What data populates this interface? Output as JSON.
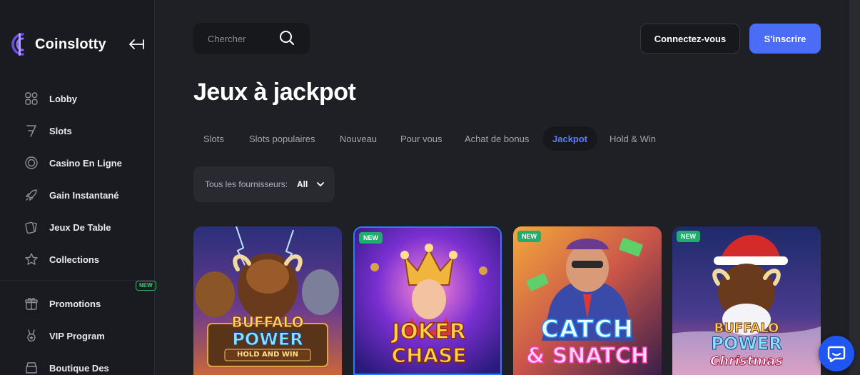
{
  "brand": {
    "name": "Coinslotty"
  },
  "sidebar": {
    "items": [
      {
        "label": "Lobby",
        "icon": "lobby-grid-icon"
      },
      {
        "label": "Slots",
        "icon": "seven-icon"
      },
      {
        "label": "Casino En Ligne",
        "icon": "chip-icon"
      },
      {
        "label": "Gain Instantané",
        "icon": "rocket-icon"
      },
      {
        "label": "Jeux De Table",
        "icon": "cards-icon"
      },
      {
        "label": "Collections",
        "icon": "star-icon"
      },
      {
        "label": "Promotions",
        "icon": "gift-icon"
      },
      {
        "label": "VIP Program",
        "icon": "medal-icon"
      },
      {
        "label": "Boutique Des",
        "icon": "shop-icon",
        "badge": "NEW"
      }
    ]
  },
  "header": {
    "search_placeholder": "Chercher",
    "login_label": "Connectez-vous",
    "signup_label": "S'inscrire"
  },
  "page": {
    "title": "Jeux à jackpot"
  },
  "tabs": [
    {
      "label": "Slots",
      "active": false
    },
    {
      "label": "Slots populaires",
      "active": false
    },
    {
      "label": "Nouveau",
      "active": false
    },
    {
      "label": "Pour vous",
      "active": false
    },
    {
      "label": "Achat de bonus",
      "active": false
    },
    {
      "label": "Jackpot",
      "active": true
    },
    {
      "label": "Hold & Win",
      "active": false
    }
  ],
  "filter": {
    "label": "Tous les fournisseurs:",
    "value": "All"
  },
  "games": [
    {
      "line1": "BUFFALO",
      "line2": "POWER",
      "line3": "HOLD AND WIN",
      "badge": ""
    },
    {
      "line1": "JOKER",
      "line2": "CHASE",
      "line3": "",
      "badge": "NEW"
    },
    {
      "line1": "CATCH",
      "line2": "& SNATCH",
      "line3": "",
      "badge": "NEW"
    },
    {
      "line1": "BUFFALO",
      "line2": "POWER",
      "line3": "Christmas",
      "badge": "NEW"
    }
  ],
  "colors": {
    "accent": "#4a6cf7",
    "active_tab": "#5b7cff",
    "background": "#1f2026",
    "sidebar": "#1a1b20",
    "new_badge": "#1fae6d"
  }
}
